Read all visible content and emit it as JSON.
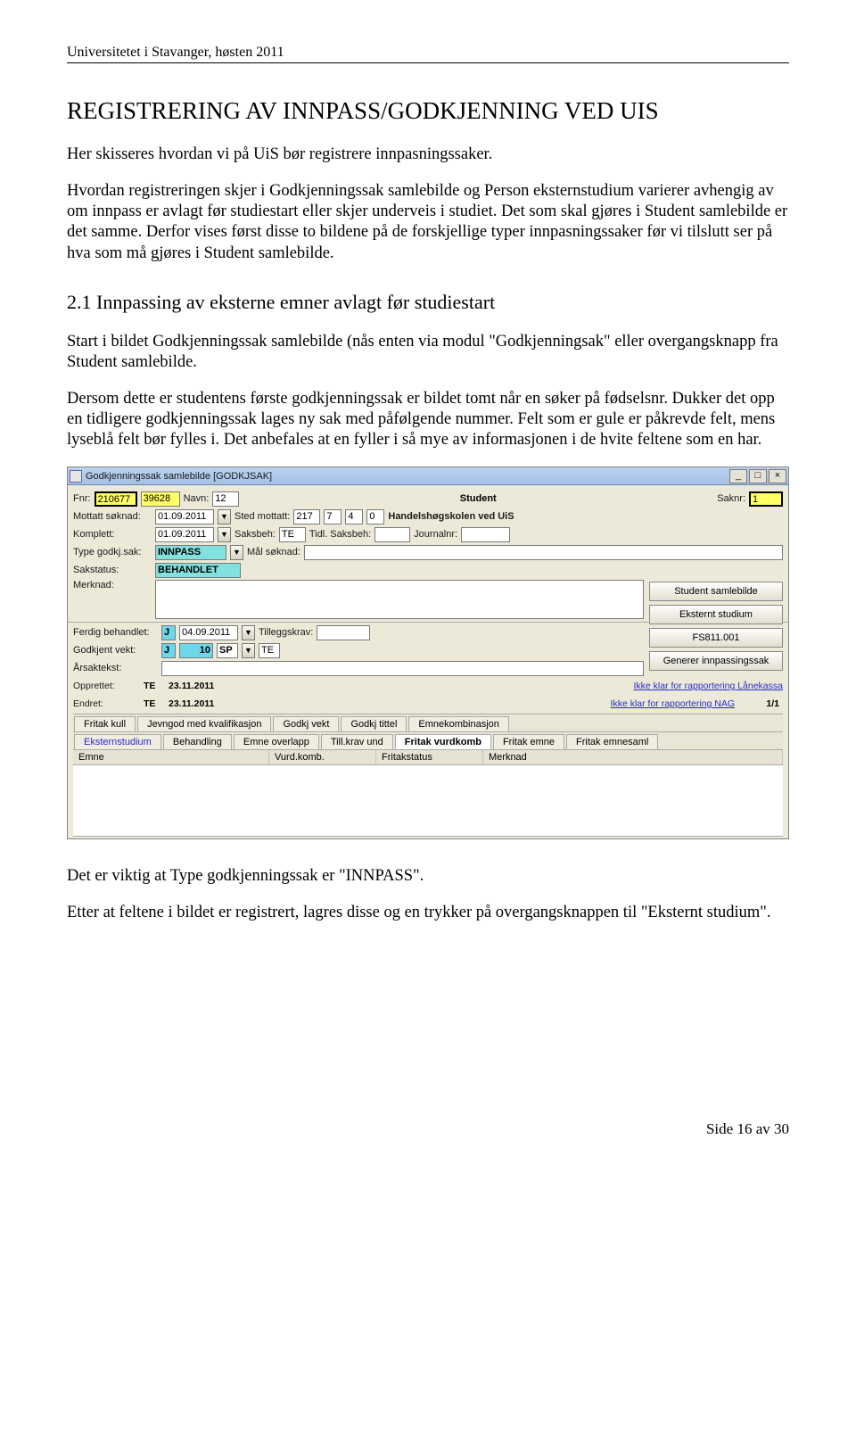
{
  "header": {
    "left": "Universitetet i Stavanger, høsten 2011",
    "right": ""
  },
  "doc": {
    "h1": "REGISTRERING AV INNPASS/GODKJENNING VED UIS",
    "p1": "Her skisseres hvordan vi på UiS bør registrere innpasningssaker.",
    "p2": "Hvordan registreringen skjer i Godkjenningssak samlebilde og Person eksternstudium varierer avhengig av om innpass er avlagt før studiestart eller skjer underveis i studiet. Det som skal gjøres i Student samlebilde er det samme. Derfor vises først disse to bildene på de forskjellige typer innpasningssaker før vi tilslutt ser på hva som må gjøres i Student samlebilde.",
    "h2": "2.1 Innpassing av eksterne emner avlagt før studiestart",
    "p3": "Start i bildet Godkjenningssak samlebilde (nås enten via modul \"Godkjenningsak\" eller overgangsknapp fra Student samlebilde.",
    "p4": "Dersom dette er studentens første godkjenningssak er bildet tomt når en søker på fødselsnr. Dukker det opp en tidligere godkjenningssak lages ny sak med påfølgende nummer. Felt som er gule er påkrevde felt, mens lyseblå felt bør fylles i. Det anbefales at en fyller i så mye av informasjonen i de hvite feltene som en har.",
    "p5": "Det er viktig at Type godkjenningssak er \"INNPASS\".",
    "p6": "Etter at feltene i bildet er registrert, lagres disse og en trykker på overgangsknappen til \"Eksternt studium\"."
  },
  "win": {
    "title": "Godkjenningssak samlebilde  [GODKJSAK]",
    "min": "_",
    "max": "□",
    "close": "×"
  },
  "form": {
    "fnr_lbl": "Fnr:",
    "fnr1": "210677",
    "fnr2": "39628",
    "navn_lbl": "Navn:",
    "navn": "12",
    "student": "Student",
    "saknr_lbl": "Saknr:",
    "saknr": "1",
    "mottatt_lbl": "Mottatt søknad:",
    "mottatt": "01.09.2011",
    "sted_lbl": "Sted mottatt:",
    "sted1": "217",
    "sted2": "7",
    "sted3": "4",
    "sted4": "0",
    "sted_name": "Handelshøgskolen ved UiS",
    "komplett_lbl": "Komplett:",
    "komplett": "01.09.2011",
    "saksbeh_lbl": "Saksbeh:",
    "saksbeh": "TE",
    "tidl_lbl": "Tidl. Saksbeh:",
    "journal_lbl": "Journalnr:",
    "type_lbl": "Type godkj.sak:",
    "type": "INNPASS",
    "maal_lbl": "Mål søknad:",
    "sakstatus_lbl": "Sakstatus:",
    "sakstatus": "BEHANDLET",
    "merknad_lbl": "Merknad:",
    "ferdig_lbl": "Ferdig behandlet:",
    "ferdig_jn": "J",
    "ferdig_dato": "04.09.2011",
    "tillegg_lbl": "Tilleggskrav:",
    "godkjent_lbl": "Godkjent vekt:",
    "godkjent_jn": "J",
    "godkjent_val": "10",
    "godkjent_unit": "SP",
    "godkjent_te": "TE",
    "arsak_lbl": "Årsaktekst:",
    "opprettet_lbl": "Opprettet:",
    "opprettet_by": "TE",
    "opprettet_dato": "23.11.2011",
    "endret_lbl": "Endret:",
    "endret_by": "TE",
    "endret_dato": "23.11.2011",
    "link1": "Ikke klar for rapportering Lånekassa",
    "link2": "Ikke klar for rapportering NAG",
    "counter": "1/1"
  },
  "side": {
    "b1": "Student samlebilde",
    "b2": "Eksternt studium",
    "b3": "FS811.001",
    "b4": "Generer innpassingssak"
  },
  "tabs1": {
    "t1": "Fritak kull",
    "t2": "Jevngod med kvalifikasjon",
    "t3": "Godkj vekt",
    "t4": "Godkj tittel",
    "t5": "Emnekombinasjon"
  },
  "tabs2": {
    "t1": "Eksternstudium",
    "t2": "Behandling",
    "t3": "Emne overlapp",
    "t4": "Till.krav und",
    "t5": "Fritak vurdkomb",
    "t6": "Fritak emne",
    "t7": "Fritak emnesaml"
  },
  "list": {
    "c1": "Emne",
    "c2": "Vurd.komb.",
    "c3": "Fritakstatus",
    "c4": "Merknad"
  },
  "footer": "Side 16 av 30"
}
